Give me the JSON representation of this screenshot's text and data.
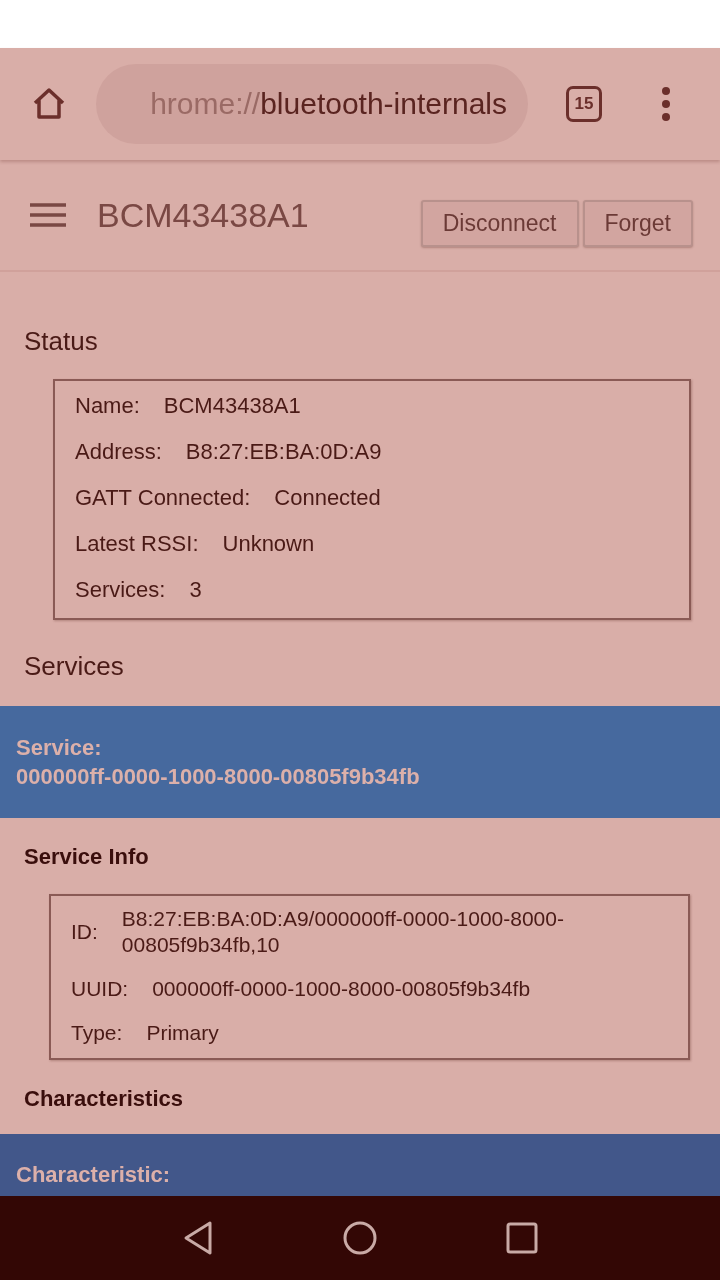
{
  "browser": {
    "url": {
      "scheme": "hrome://",
      "host": "bluetooth-internals"
    },
    "tab_count": "15"
  },
  "header": {
    "title": "BCM43438A1",
    "buttons": [
      "Disconnect",
      "Forget"
    ]
  },
  "status": {
    "heading": "Status",
    "rows": [
      {
        "label": "Name:",
        "value": "BCM43438A1"
      },
      {
        "label": "Address:",
        "value": "B8:27:EB:BA:0D:A9"
      },
      {
        "label": "GATT Connected:",
        "value": "Connected"
      },
      {
        "label": "Latest RSSI:",
        "value": "Unknown"
      },
      {
        "label": "Services:",
        "value": "3"
      }
    ]
  },
  "services": {
    "heading": "Services",
    "items": [
      {
        "title": "Service:",
        "uuid": "000000ff-0000-1000-8000-00805f9b34fb",
        "info_heading": "Service Info",
        "info_rows": [
          {
            "label": "ID:",
            "value": "B8:27:EB:BA:0D:A9/000000ff-0000-1000-8000-00805f9b34fb,10"
          },
          {
            "label": "UUID:",
            "value": "000000ff-0000-1000-8000-00805f9b34fb"
          },
          {
            "label": "Type:",
            "value": "Primary"
          }
        ],
        "characteristics_heading": "Characteristics",
        "characteristics": [
          {
            "title": "Characteristic:"
          }
        ]
      }
    ]
  }
}
